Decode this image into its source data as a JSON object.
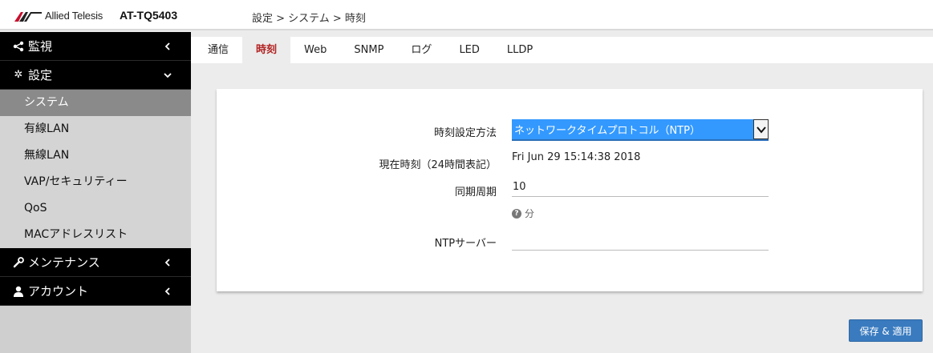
{
  "header": {
    "brand": "Allied Telesis",
    "model": "AT-TQ5403",
    "breadcrumb": "設定 > システム > 時刻"
  },
  "sidebar": {
    "sections": [
      {
        "label": "監視",
        "icon": "share-icon",
        "expanded": false
      },
      {
        "label": "設定",
        "icon": "gear-icon",
        "expanded": true
      },
      {
        "label": "メンテナンス",
        "icon": "wrench-icon",
        "expanded": false
      },
      {
        "label": "アカウント",
        "icon": "user-icon",
        "expanded": false
      }
    ],
    "items": [
      {
        "label": "システム",
        "active": true
      },
      {
        "label": "有線LAN"
      },
      {
        "label": "無線LAN"
      },
      {
        "label": "VAP/セキュリティー"
      },
      {
        "label": "QoS"
      },
      {
        "label": "MACアドレスリスト"
      }
    ]
  },
  "tabs": [
    {
      "label": "通信"
    },
    {
      "label": "時刻",
      "active": true
    },
    {
      "label": "Web"
    },
    {
      "label": "SNMP"
    },
    {
      "label": "ログ"
    },
    {
      "label": "LED"
    },
    {
      "label": "LLDP"
    }
  ],
  "form": {
    "method_label": "時刻設定方法",
    "method_value": "ネットワークタイムプロトコル（NTP）",
    "current_time_label": "現在時刻（24時間表記）",
    "current_time_value": "Fri Jun 29 15:14:38 2018",
    "sync_label": "同期周期",
    "sync_value": "10",
    "sync_unit": "分",
    "ntp_label": "NTPサーバー",
    "ntp_value": ""
  },
  "actions": {
    "save_label": "保存 & 適用"
  },
  "colors": {
    "accent": "#3399ff",
    "button": "#3a7bbf",
    "active_tab": "#b22222"
  }
}
